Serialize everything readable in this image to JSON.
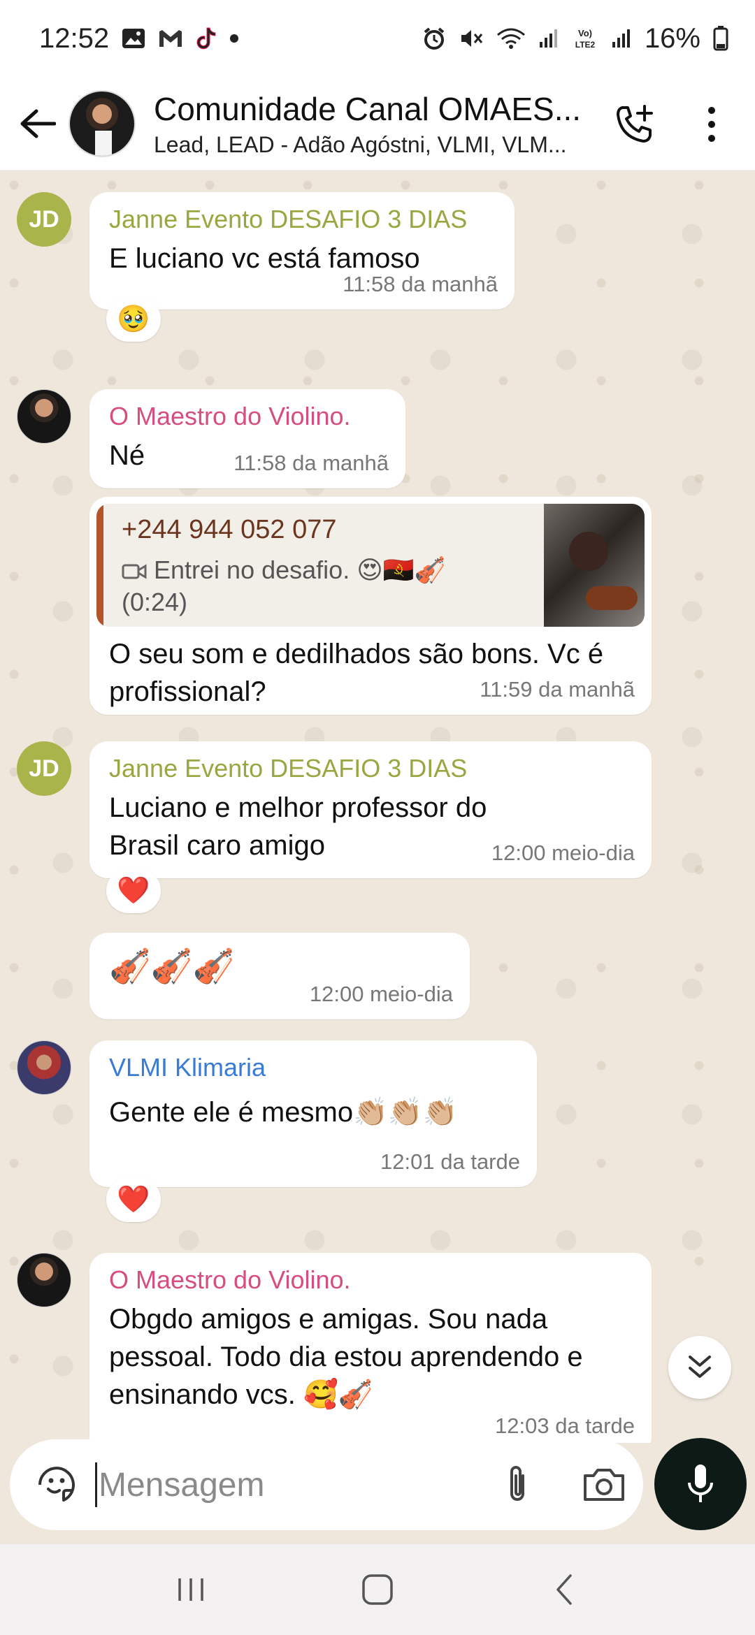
{
  "status_bar": {
    "time": "12:52",
    "battery": "16%",
    "left_icons": [
      "gallery-icon",
      "gmail-icon",
      "tiktok-icon",
      "dot-icon"
    ],
    "right_icons": [
      "alarm-icon",
      "mute-icon",
      "wifi-icon",
      "signal-icon",
      "volte-icon",
      "signal-icon",
      "battery-icon"
    ],
    "volte_label": "Vo)\nLTE2"
  },
  "header": {
    "title": "Comunidade Canal OMAES...",
    "subtitle": "Lead, LEAD - Adão Agóstni, VLMI, VLM..."
  },
  "messages": [
    {
      "sender": "Janne Evento DESAFIO 3 DIAS",
      "avatar_initials": "JD",
      "text": "E luciano vc está famoso",
      "time": "11:58 da manhã",
      "reaction": "🥹"
    },
    {
      "sender": "O Maestro do Violino.",
      "text": "Né",
      "time": "11:58 da manhã"
    },
    {
      "quote": {
        "author": "+244 944 052 077",
        "text": "Entrei no desafio. 😍🇦🇴🎻",
        "duration": "(0:24)"
      },
      "text": "O seu som e dedilhados são bons. Vc é profissional?",
      "time": "11:59 da manhã"
    },
    {
      "sender": "Janne Evento DESAFIO 3 DIAS",
      "avatar_initials": "JD",
      "text": "Luciano e melhor professor do Brasil caro amigo",
      "time": "12:00 meio-dia",
      "reaction": "❤️"
    },
    {
      "text": "🎻🎻🎻",
      "time": "12:00 meio-dia"
    },
    {
      "sender": "VLMI Klimaria",
      "text": "Gente ele é mesmo👏🏼👏🏼👏🏼",
      "time": "12:01 da tarde",
      "reaction": "❤️"
    },
    {
      "sender": "O Maestro do Violino.",
      "text": "Obgdo amigos e amigas. Sou nada pessoal. Todo dia estou aprendendo e ensinando vcs. 🥰🎻",
      "time": "12:03 da tarde"
    }
  ],
  "composer": {
    "placeholder": "Mensagem"
  },
  "colors": {
    "chat_bg": "#efe7dc",
    "green_sender": "#9aa640",
    "pink_sender": "#d64d80",
    "blue_sender": "#3a7bd5",
    "mic_button": "#0e1a16"
  }
}
